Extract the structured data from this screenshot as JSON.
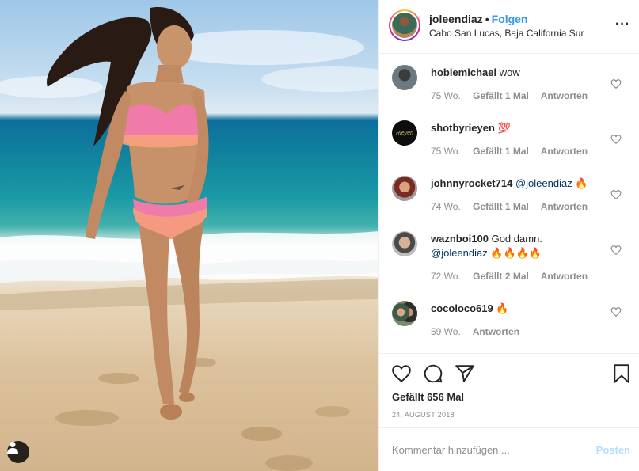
{
  "post": {
    "username": "joleendiaz",
    "separator": "•",
    "follow_label": "Folgen",
    "location": "Cabo San Lucas, Baja California Sur",
    "more_label": "···"
  },
  "comments": [
    {
      "username": "hobiemichael",
      "text": "wow",
      "mention": "",
      "emoji": "",
      "age": "75 Wo.",
      "likes": "Gefällt 1 Mal",
      "reply": "Antworten"
    },
    {
      "username": "shotbyrieyen",
      "text": "",
      "mention": "",
      "emoji": "💯",
      "age": "75 Wo.",
      "likes": "Gefällt 1 Mal",
      "reply": "Antworten",
      "avatar_text": "Rieyen"
    },
    {
      "username": "johnnyrocket714",
      "text": "",
      "mention": "@joleendiaz",
      "emoji": "🔥",
      "age": "74 Wo.",
      "likes": "Gefällt 1 Mal",
      "reply": "Antworten"
    },
    {
      "username": "waznboi100",
      "text": "God damn.",
      "mention": "@joleendiaz",
      "emoji": "🔥🔥🔥🔥",
      "age": "72 Wo.",
      "likes": "Gefällt 2 Mal",
      "reply": "Antworten"
    },
    {
      "username": "cocoloco619",
      "text": "",
      "mention": "",
      "emoji": "🔥",
      "age": "59 Wo.",
      "likes": "",
      "reply": "Antworten"
    }
  ],
  "actions": {
    "likes": "Gefällt 656 Mal",
    "date": "24. AUGUST 2018"
  },
  "add_comment": {
    "placeholder": "Kommentar hinzufügen ...",
    "post_label": "Posten"
  },
  "icons": {
    "like": "heart-icon",
    "comment": "comment-bubble-icon",
    "share": "paper-plane-icon",
    "save": "bookmark-icon",
    "user_tag": "user-silhouette-icon",
    "more": "more-dots-icon"
  },
  "colors": {
    "link_blue": "#3897f0",
    "mention_blue": "#003569",
    "meta_gray": "#8e8e8e",
    "post_disabled": "#b2dffc",
    "border": "#efefef"
  }
}
